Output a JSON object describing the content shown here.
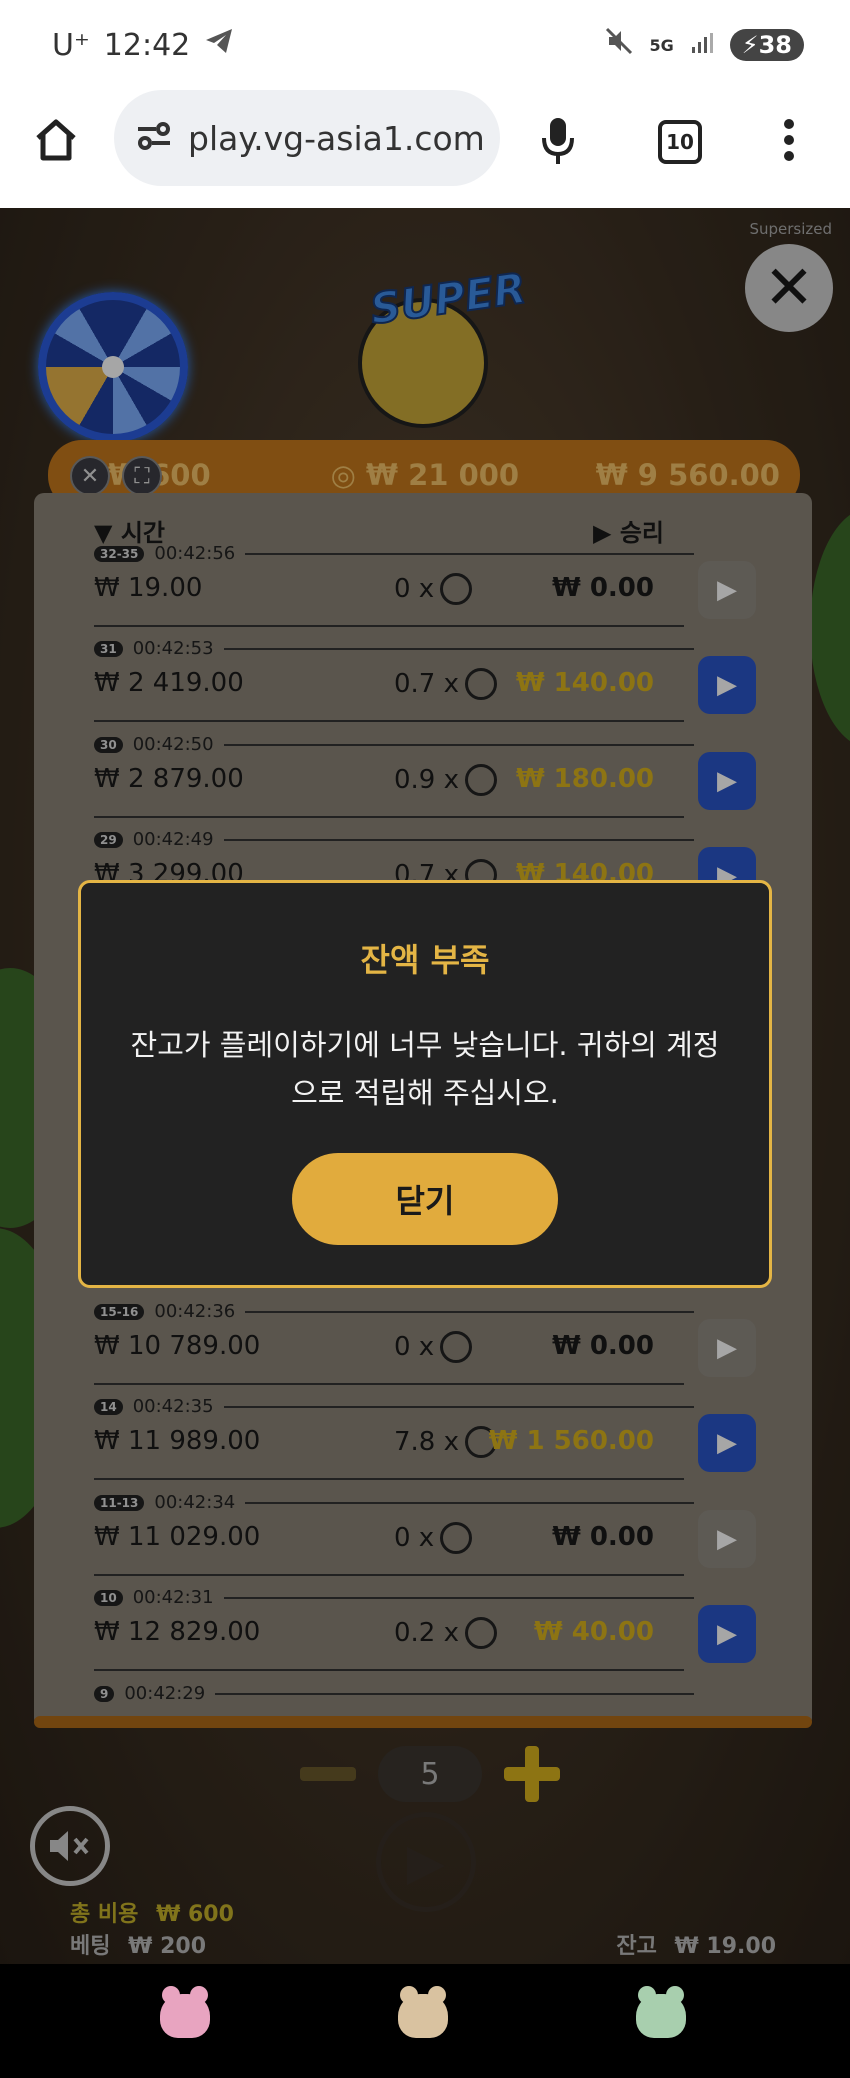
{
  "status_bar": {
    "carrier": "U⁺",
    "time": "12:42",
    "network": "5G",
    "battery": "38"
  },
  "browser": {
    "url": "play.vg-asia1.com",
    "tab_count": "10"
  },
  "game": {
    "supersized_label": "Supersized",
    "logo_text": "SUPER",
    "top_bar": {
      "bet_value": "₩ 600",
      "chip_value": "₩ 21 000",
      "balance_value": "₩ 9 560.00"
    },
    "history_header": {
      "time_label": "시간",
      "win_label": "승리"
    },
    "history_rows": [
      {
        "badge": "32-35",
        "time": "00:42:56",
        "bet": "₩ 19.00",
        "multiplier": "0 x",
        "payout": "₩ 0.00",
        "win": false
      },
      {
        "badge": "31",
        "time": "00:42:53",
        "bet": "₩ 2 419.00",
        "multiplier": "0.7 x",
        "payout": "₩ 140.00",
        "win": true
      },
      {
        "badge": "30",
        "time": "00:42:50",
        "bet": "₩ 2 879.00",
        "multiplier": "0.9 x",
        "payout": "₩ 180.00",
        "win": true
      },
      {
        "badge": "29",
        "time": "00:42:49",
        "bet": "₩ 3 299.00",
        "multiplier": "0.7 x",
        "payout": "₩ 140.00",
        "win": true
      },
      {
        "badge": "15-16",
        "time": "00:42:36",
        "bet": "₩ 10 789.00",
        "multiplier": "0 x",
        "payout": "₩ 0.00",
        "win": false
      },
      {
        "badge": "14",
        "time": "00:42:35",
        "bet": "₩ 11 989.00",
        "multiplier": "7.8 x",
        "payout": "₩ 1 560.00",
        "win": true
      },
      {
        "badge": "11-13",
        "time": "00:42:34",
        "bet": "₩ 11 029.00",
        "multiplier": "0 x",
        "payout": "₩ 0.00",
        "win": false
      },
      {
        "badge": "10",
        "time": "00:42:31",
        "bet": "₩ 12 829.00",
        "multiplier": "0.2 x",
        "payout": "₩ 40.00",
        "win": true
      },
      {
        "badge": "9",
        "time": "00:42:29",
        "bet": "",
        "multiplier": "",
        "payout": "",
        "win": false
      }
    ],
    "stepper_value": "5",
    "total_cost_label": "총 비용",
    "total_cost_value": "₩ 600",
    "bet_label": "베팅",
    "bet_value": "₩ 200",
    "balance_label": "잔고",
    "balance_value": "₩ 19.00"
  },
  "modal": {
    "title": "잔액 부족",
    "message": "잔고가 플레이하기에 너무 낮습니다. 귀하의 계정으로 적립해 주십시오.",
    "close_button": "닫기"
  },
  "colors": {
    "accent_gold": "#e1ab3d",
    "win_yellow": "#d9b31e",
    "play_blue": "#2a55c8"
  }
}
